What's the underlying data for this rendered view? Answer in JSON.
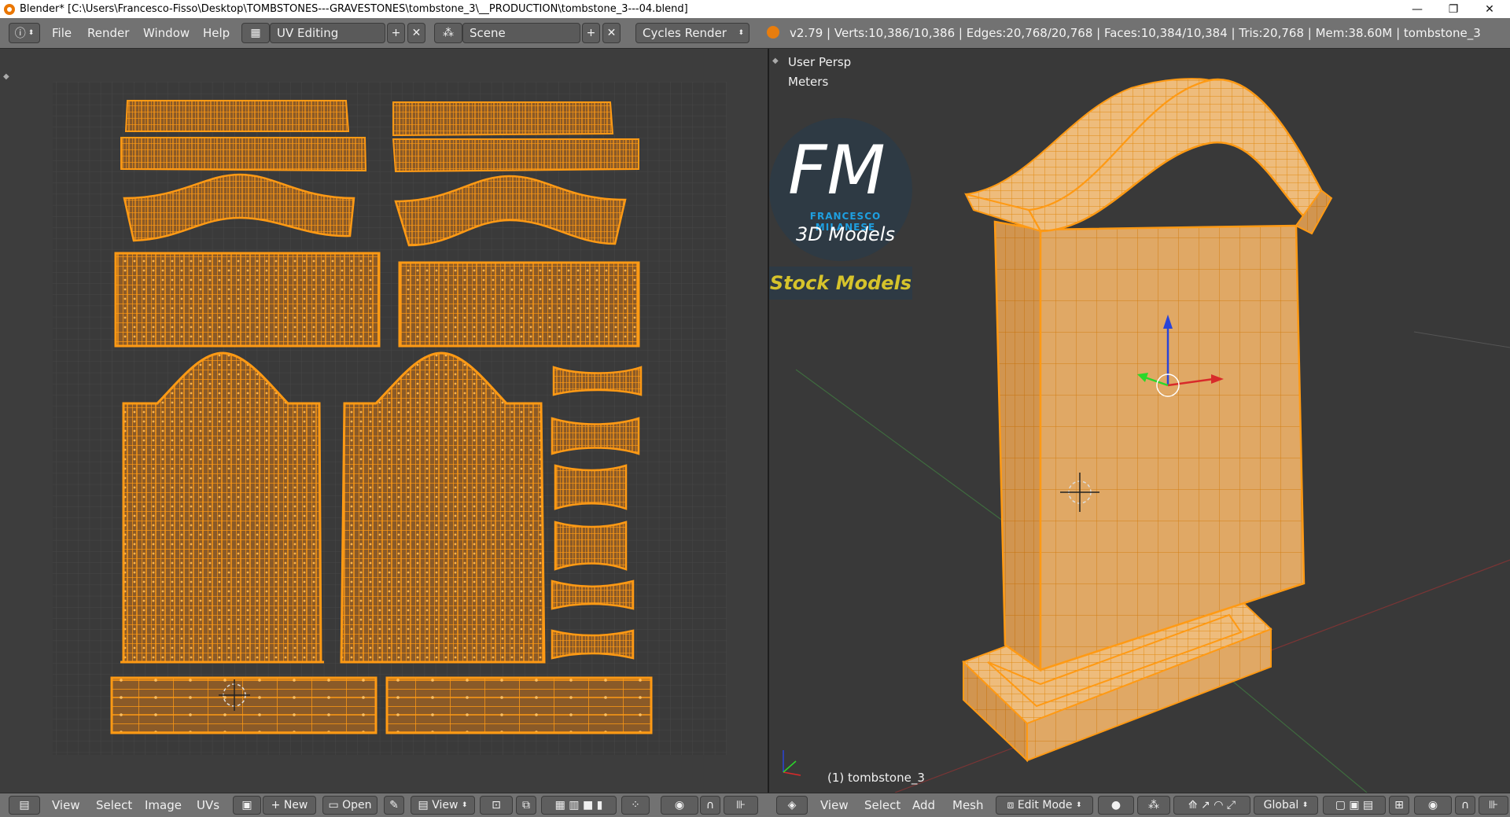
{
  "window": {
    "title": "Blender* [C:\\Users\\Francesco-Fisso\\Desktop\\TOMBSTONES---GRAVESTONES\\tombstone_3\\__PRODUCTION\\tombstone_3---04.blend]",
    "minimize": "—",
    "maximize": "❐",
    "close": "✕"
  },
  "menubar": {
    "info_icon": "ⓘ",
    "menus": [
      "File",
      "Render",
      "Window",
      "Help"
    ],
    "layout": "UV Editing",
    "scene": "Scene",
    "engine": "Cycles Render",
    "stats": "v2.79 | Verts:10,386/10,386 | Edges:20,768/20,768 | Faces:10,384/10,384 | Tris:20,768 | Mem:38.60M | tombstone_3"
  },
  "viewport": {
    "view_name": "User Persp",
    "units": "Meters",
    "object_label": "(1) tombstone_3"
  },
  "logo": {
    "letters": "FM",
    "brand": "FRANCESCO MILANESE",
    "tagline": "3D Models",
    "stock": "Stock Models"
  },
  "uv_footer": {
    "menus": [
      "View",
      "Select",
      "Image",
      "UVs"
    ],
    "new": "New",
    "open": "Open",
    "view": "View"
  },
  "vp_footer": {
    "menus": [
      "View",
      "Select",
      "Add",
      "Mesh"
    ],
    "mode": "Edit Mode",
    "orientation": "Global"
  },
  "colors": {
    "wire": "#ff9a14",
    "face": "#8a5a28",
    "panel": "#727272",
    "logo_blue": "#1e9fe0",
    "logo_yellow": "#d6c32b"
  }
}
